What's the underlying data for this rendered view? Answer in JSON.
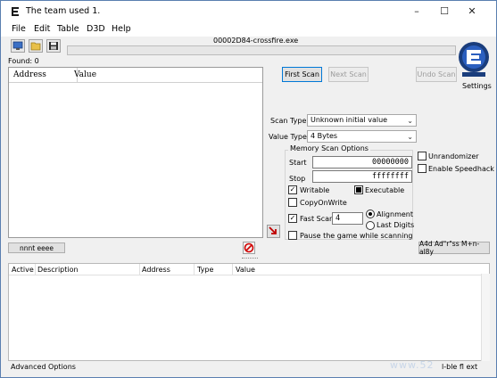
{
  "window": {
    "title": "The team used 1.",
    "minimize": "–",
    "maximize": "☐",
    "close": "✕"
  },
  "menu": [
    "File",
    "Edit",
    "Table",
    "D3D",
    "Help"
  ],
  "process_title": "00002D84-crossfire.exe",
  "found_label": "Found: 0",
  "results_columns": {
    "address": "Address",
    "value": "Value"
  },
  "scan_buttons": {
    "first": "First Scan",
    "next": "Next Scan",
    "undo": "Undo Scan"
  },
  "settings_label": "Settings",
  "scan_type": {
    "label": "Scan Type",
    "value": "Unknown initial value"
  },
  "value_type": {
    "label": "Value Type",
    "value": "4 Bytes"
  },
  "memory_options": {
    "title": "Memory Scan Options",
    "start_label": "Start",
    "start_value": "00000000",
    "stop_label": "Stop",
    "stop_value": "ffffffff",
    "writable": "Writable",
    "executable": "Executable",
    "copy_on_write": "CopyOnWrite",
    "fast_scan": "Fast Scan",
    "fast_scan_value": "4",
    "alignment": "Alignment",
    "last_digits": "Last Digits",
    "pause": "Pause the game while scanning"
  },
  "checkboxes": {
    "writable": true,
    "executable": true,
    "copy_on_write": false,
    "fast_scan": true,
    "pause": false,
    "unrandomizer": false,
    "speedhack": false
  },
  "side_options": {
    "unrandomizer": "Unrandomizer",
    "speedhack": "Enable Speedhack"
  },
  "memory_view_button": "nnnt eeee",
  "add_address_button": "A4d Ad\"r\"ss M+n-al8y",
  "address_list_columns": {
    "active": "Active",
    "description": "Description",
    "address": "Address",
    "type": "Type",
    "value": "Value"
  },
  "advanced_options": "Advanced Options",
  "table_extras": "l-ble ﬂ ext",
  "watermark": "www.52"
}
